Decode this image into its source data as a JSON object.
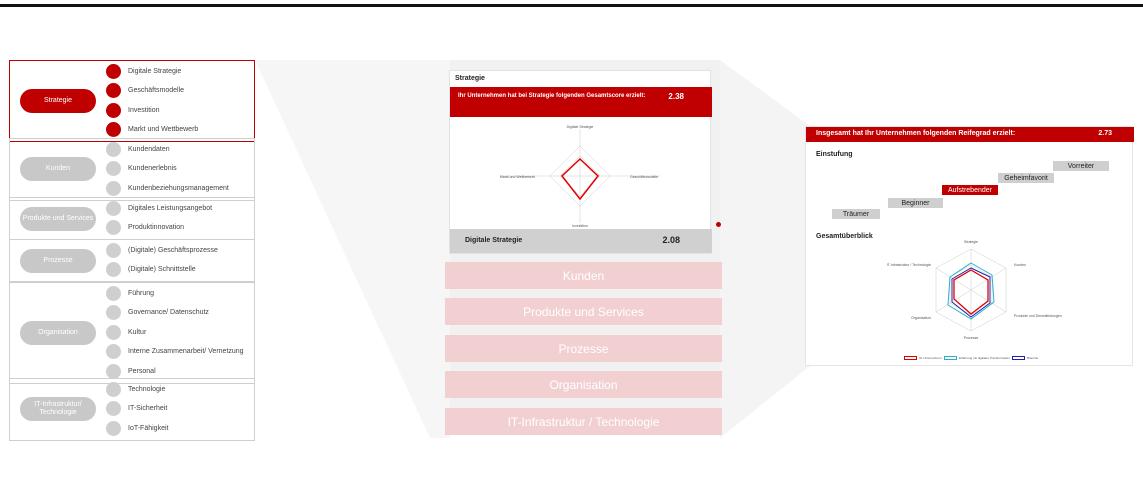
{
  "colors": {
    "accent": "#c00000",
    "inactive": "#cfcfcf",
    "pink": "#f2d0d1"
  },
  "left_panel": {
    "groups": [
      {
        "label": "Strategie",
        "active": true,
        "items": [
          "Digitale Strategie",
          "Geschäftsmodelle",
          "Investition",
          "Markt und Wettbewerb"
        ]
      },
      {
        "label": "Kunden",
        "active": false,
        "items": [
          "Kundendaten",
          "Kundenerlebnis",
          "Kundenbeziehungsmanagement"
        ]
      },
      {
        "label": "Produkte und Services",
        "active": false,
        "items": [
          "Digitales Leistungsangebot",
          "Produktinnovation"
        ]
      },
      {
        "label": "Prozesse",
        "active": false,
        "items": [
          "(Digitale) Geschäftsprozesse",
          "(Digitale) Schnittstelle"
        ]
      },
      {
        "label": "Organisation",
        "active": false,
        "items": [
          "Führung",
          "Governance/ Datenschutz",
          "Kultur",
          "Interne Zusammenarbeit/ Vernetzung",
          "Personal"
        ]
      },
      {
        "label": "IT-Infrastruktur/ Technologie",
        "active": false,
        "items": [
          "Technologie",
          "IT-Sicherheit",
          "IoT-Fähigkeit"
        ]
      }
    ]
  },
  "strategy_card": {
    "title": "Strategie",
    "banner_text": "Ihr Unternehmen hat bei Strategie folgenden Gesamtscore erzielt:",
    "banner_score": "2.38",
    "radar_labels": [
      "Digitale Strategie",
      "Geschäftsmodelle",
      "Investition",
      "Markt und Wettbewerb"
    ],
    "radar_values": [
      2.0,
      2.5,
      2.2,
      2.8
    ],
    "footer_label": "Digitale Strategie",
    "footer_score": "2.08"
  },
  "category_buttons": [
    "Kunden",
    "Produkte und Services",
    "Prozesse",
    "Organisation",
    "IT-Infrastruktur / Technologie"
  ],
  "result_card": {
    "banner_text": "Insgesamt hat Ihr Unternehmen folgenden Reifegrad erzielt:",
    "banner_score": "2.73",
    "einstufung_heading": "Einstufung",
    "levels": [
      "Träumer",
      "Beginner",
      "Aufstrebender",
      "Geheimfavorit",
      "Vorreiter"
    ],
    "highlighted_level": "Aufstrebender",
    "overview_heading": "Gesamtüberblick",
    "radar_labels": [
      "Strategie",
      "Kunden",
      "Produkte und Dienstleistungen",
      "Prozesse",
      "Organisation",
      "IT-Infrastruktur / Technologie"
    ],
    "legend": [
      {
        "label": "Ihr Unternehmen",
        "color": "#e00000"
      },
      {
        "label": "Erfahrung mit digitalen Transformation",
        "color": "#2ab0c8"
      },
      {
        "label": "Branche",
        "color": "#2020b0"
      }
    ]
  }
}
